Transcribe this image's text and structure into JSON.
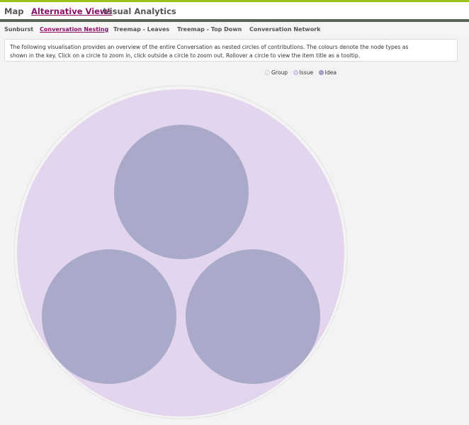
{
  "nav": {
    "items": [
      {
        "label": "Map",
        "active": false
      },
      {
        "label": "Alternative Views",
        "active": true
      },
      {
        "label": "Visual Analytics",
        "active": false
      }
    ]
  },
  "subnav": {
    "items": [
      {
        "label": "Sunburst",
        "active": false
      },
      {
        "label": "Conversation Nesting",
        "active": true
      },
      {
        "label": "Treemap - Leaves",
        "active": false
      },
      {
        "label": "Treemap - Top Down",
        "active": false
      },
      {
        "label": "Conversation Network",
        "active": false
      }
    ]
  },
  "description": {
    "line1": "The following visualisation provides an overview of the entire Conversation as nested circles of contributions. The colours denote the node types as",
    "line2": "shown in the key. Click on a circle to zoom in, click outside a circle to zoom out. Rollover a circle to view the item title as a tooltip."
  },
  "legend": {
    "items": [
      {
        "label": "Group",
        "color": "#f4f4f4",
        "border": "#cfcfcf"
      },
      {
        "label": "Issue",
        "color": "#e4d5ee",
        "border": "#c9b4da"
      },
      {
        "label": "Idea",
        "color": "#a9a9c9",
        "border": "#8d8db4"
      }
    ]
  },
  "colors": {
    "accent": "#8b0d6a",
    "group": "#f4f4f4",
    "issue": "#e4d5ee",
    "idea": "#a9a9c9"
  },
  "visualisation": {
    "root_type": "group",
    "issue_count": 1,
    "idea_count": 3
  }
}
